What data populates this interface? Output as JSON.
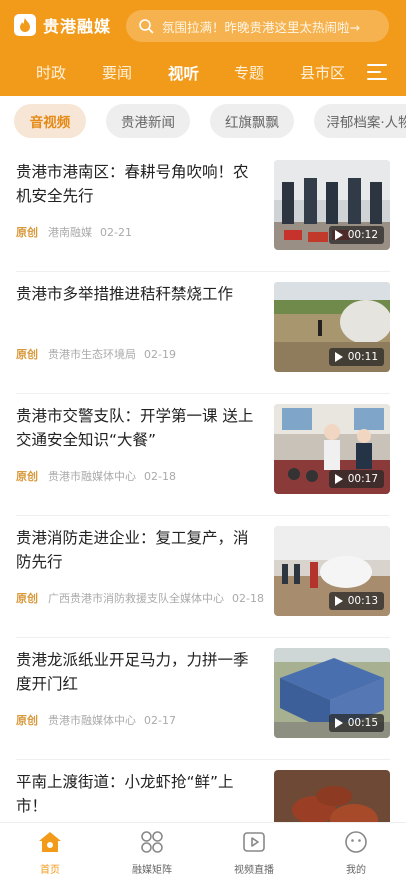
{
  "header": {
    "app_name": "贵港融媒",
    "search_placeholder": "氛围拉满！昨晚贵港这里太热闹啦→",
    "tabs": [
      {
        "label": "时政",
        "active": false
      },
      {
        "label": "要闻",
        "active": false
      },
      {
        "label": "视听",
        "active": true
      },
      {
        "label": "专题",
        "active": false
      },
      {
        "label": "县市区",
        "active": false
      }
    ],
    "accent_color": "#f29b1b"
  },
  "chips": [
    {
      "label": "音视频",
      "active": true
    },
    {
      "label": "贵港新闻",
      "active": false
    },
    {
      "label": "红旗飘飘",
      "active": false
    },
    {
      "label": "浔郁档案·人物",
      "active": false
    }
  ],
  "articles": [
    {
      "title": "贵港市港南区：春耕号角吹响！农机安全先行",
      "tag": "原创",
      "source": "港南融媒",
      "date": "02-21",
      "duration": "00:12"
    },
    {
      "title": "贵港市多举措推进秸秆禁烧工作",
      "tag": "原创",
      "source": "贵港市生态环境局",
      "date": "02-19",
      "duration": "00:11"
    },
    {
      "title": "贵港市交警支队：开学第一课 送上交通安全知识“大餐”",
      "tag": "原创",
      "source": "贵港市融媒体中心",
      "date": "02-18",
      "duration": "00:17"
    },
    {
      "title": "贵港消防走进企业：复工复产，消防先行",
      "tag": "原创",
      "source": "广西贵港市消防救援支队全媒体中心",
      "date": "02-18",
      "duration": "00:13"
    },
    {
      "title": "贵港龙派纸业开足马力，力拼一季度开门红",
      "tag": "原创",
      "source": "贵港市融媒体中心",
      "date": "02-17",
      "duration": "00:15"
    },
    {
      "title": "平南上渡街道：小龙虾抢“鲜”上市！",
      "tag": "",
      "source": "",
      "date": "",
      "duration": ""
    }
  ],
  "bottom_nav": [
    {
      "label": "首页",
      "icon": "home-icon",
      "active": true
    },
    {
      "label": "融媒矩阵",
      "icon": "matrix-icon",
      "active": false
    },
    {
      "label": "视频直播",
      "icon": "video-play-icon",
      "active": false
    },
    {
      "label": "我的",
      "icon": "profile-icon",
      "active": false
    }
  ]
}
